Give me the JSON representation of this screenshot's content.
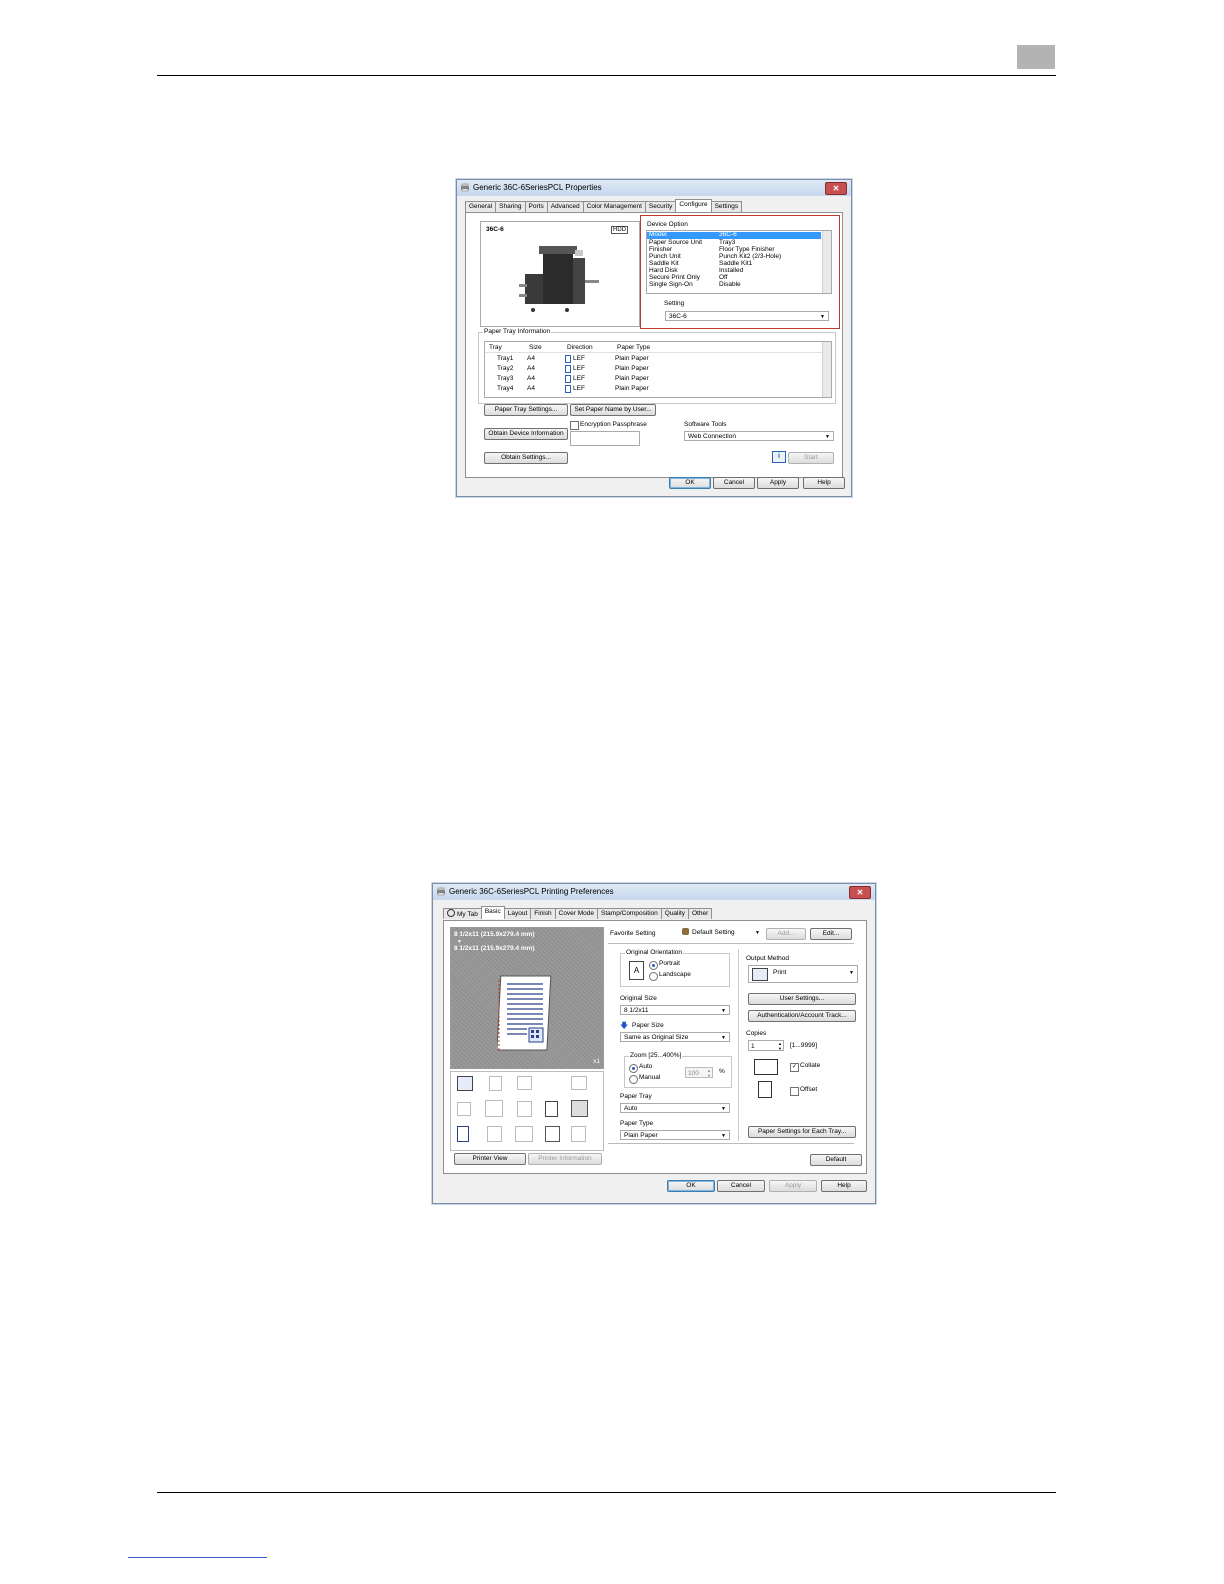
{
  "dialog1": {
    "title": "Generic 36C-6SeriesPCL Properties",
    "tabs": [
      "General",
      "Sharing",
      "Ports",
      "Advanced",
      "Color Management",
      "Security",
      "Configure",
      "Settings"
    ],
    "active_tab": "Configure",
    "model_name": "36C-6",
    "hdd_badge": "HDD",
    "device_option_label": "Device Option",
    "device_options": [
      {
        "name": "Model",
        "value": "36C-6"
      },
      {
        "name": "Paper Source Unit",
        "value": "Tray3"
      },
      {
        "name": "Finisher",
        "value": "Floor Type Finisher"
      },
      {
        "name": "Punch Unit",
        "value": "Punch Kit2 (2/3-Hole)"
      },
      {
        "name": "Saddle Kit",
        "value": "Saddle Kit1"
      },
      {
        "name": "Hard Disk",
        "value": "Installed"
      },
      {
        "name": "Secure Print Only",
        "value": "Off"
      },
      {
        "name": "Single Sign-On",
        "value": "Disable"
      }
    ],
    "setting_label": "Setting",
    "setting_value": "36C-6",
    "paper_tray_info_label": "Paper Tray Information",
    "tray_columns": [
      "Tray",
      "Size",
      "Direction",
      "Paper Type"
    ],
    "trays": [
      {
        "tray": "Tray1",
        "size": "A4",
        "direction": "LEF",
        "type": "Plain Paper"
      },
      {
        "tray": "Tray2",
        "size": "A4",
        "direction": "LEF",
        "type": "Plain Paper"
      },
      {
        "tray": "Tray3",
        "size": "A4",
        "direction": "LEF",
        "type": "Plain Paper"
      },
      {
        "tray": "Tray4",
        "size": "A4",
        "direction": "LEF",
        "type": "Plain Paper"
      }
    ],
    "paper_tray_settings_btn": "Paper Tray Settings...",
    "set_paper_name_btn": "Set Paper Name by User...",
    "obtain_device_info_btn": "Obtain Device Information",
    "encryption_label": "Encryption Passphrase",
    "software_tools_label": "Software Tools",
    "software_tools_value": "Web Connection",
    "obtain_settings_btn": "Obtain Settings...",
    "start_btn": "Start",
    "ok": "OK",
    "cancel": "Cancel",
    "apply": "Apply",
    "help": "Help"
  },
  "dialog2": {
    "title": "Generic 36C-6SeriesPCL Printing Preferences",
    "tabs": [
      "My Tab",
      "Basic",
      "Layout",
      "Finish",
      "Cover Mode",
      "Stamp/Composition",
      "Quality",
      "Other"
    ],
    "active_tab": "Basic",
    "preview_size_1": "8 1/2x11 (215.9x279.4 mm)",
    "preview_size_2": "8 1/2x11 (215.9x279.4 mm)",
    "preview_copies": "x1",
    "printer_view_btn": "Printer View",
    "printer_info_btn": "Printer Information",
    "favorite_label": "Favorite Setting",
    "favorite_value": "Default Setting",
    "add_btn": "Add...",
    "edit_btn": "Edit...",
    "orientation_label": "Original Orientation",
    "portrait": "Portrait",
    "landscape": "Landscape",
    "original_size_label": "Original Size",
    "original_size_value": "8 1/2x11",
    "paper_size_label": "Paper Size",
    "paper_size_value": "Same as Original Size",
    "zoom_label": "Zoom [25...400%]",
    "zoom_auto": "Auto",
    "zoom_manual": "Manual",
    "zoom_value": "100",
    "zoom_unit": "%",
    "paper_tray_label": "Paper Tray",
    "paper_tray_value": "Auto",
    "paper_type_label": "Paper Type",
    "paper_type_value": "Plain Paper",
    "output_method_label": "Output Method",
    "output_method_value": "Print",
    "user_settings_btn": "User Settings...",
    "auth_btn": "Authentication/Account Track...",
    "copies_label": "Copies",
    "copies_value": "1",
    "copies_range": "[1...9999]",
    "collate": "Collate",
    "offset": "Offset",
    "paper_each_tray_btn": "Paper Settings for Each Tray...",
    "default_btn": "Default",
    "ok": "OK",
    "cancel": "Cancel",
    "apply": "Apply",
    "help": "Help"
  },
  "colors": {
    "selection": "#3399ff",
    "highlight_box": "#c0392b",
    "titlebar": "#c5d7ee"
  }
}
